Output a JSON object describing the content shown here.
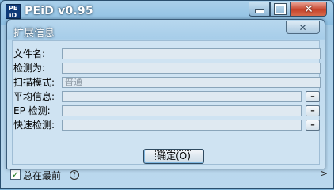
{
  "main_window": {
    "icon_label": "PE iD",
    "title": "PEiD v0.95",
    "close_symbol": "✕",
    "checkbox_mark": "✓",
    "checkbox_label": "总在最前",
    "help_symbol": "?",
    "arrow_symbol": ">"
  },
  "dialog": {
    "title": "扩展信息",
    "close_symbol": "✕",
    "rows": [
      {
        "label": "文件名:",
        "value": ""
      },
      {
        "label": "检测为:",
        "value": ""
      },
      {
        "label": "扫描模式:",
        "value": "普通"
      },
      {
        "label": "平均信息:",
        "value": "",
        "button": "–"
      },
      {
        "label": "EP 检测:",
        "value": "",
        "button": "–"
      },
      {
        "label": "快速检测:",
        "value": "",
        "button": "–"
      }
    ],
    "ok_label_main": "确定",
    "ok_label_hotkey": "(O)"
  },
  "colors": {
    "title_text": "#ffffff",
    "close_red": "#c6442c",
    "accent_blue": "#8dbfe2"
  }
}
